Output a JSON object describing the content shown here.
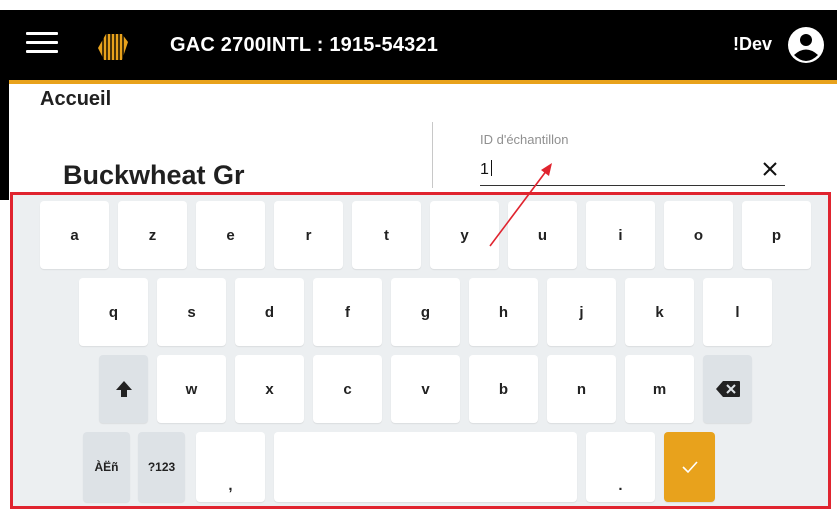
{
  "header": {
    "title": "GAC 2700INTL : 1915-54321",
    "user_label": "!Dev",
    "menu_icon": "hamburger-menu-icon",
    "logo_icon": "gac-logo-icon",
    "user_icon": "account-circle-icon"
  },
  "page": {
    "title": "Accueil",
    "product_name": "Buckwheat Gr"
  },
  "sample_field": {
    "label": "ID d'échantillon",
    "value": "1",
    "clear_icon": "close-icon"
  },
  "keyboard": {
    "row1": [
      "a",
      "z",
      "e",
      "r",
      "t",
      "y",
      "u",
      "i",
      "o",
      "p"
    ],
    "row2": [
      "q",
      "s",
      "d",
      "f",
      "g",
      "h",
      "j",
      "k",
      "l"
    ],
    "row3": [
      "w",
      "x",
      "c",
      "v",
      "b",
      "n",
      "m"
    ],
    "shift_icon": "shift-arrow-icon",
    "backspace_icon": "backspace-icon",
    "accent_key": "ÀËñ",
    "symbols_key": "?123",
    "comma_key": ",",
    "period_key": ".",
    "enter_icon": "checkmark-icon"
  },
  "colors": {
    "header_bg": "#000000",
    "accent": "#e8a21c",
    "highlight": "#e0242f",
    "keyboard_bg": "#eceff1"
  }
}
